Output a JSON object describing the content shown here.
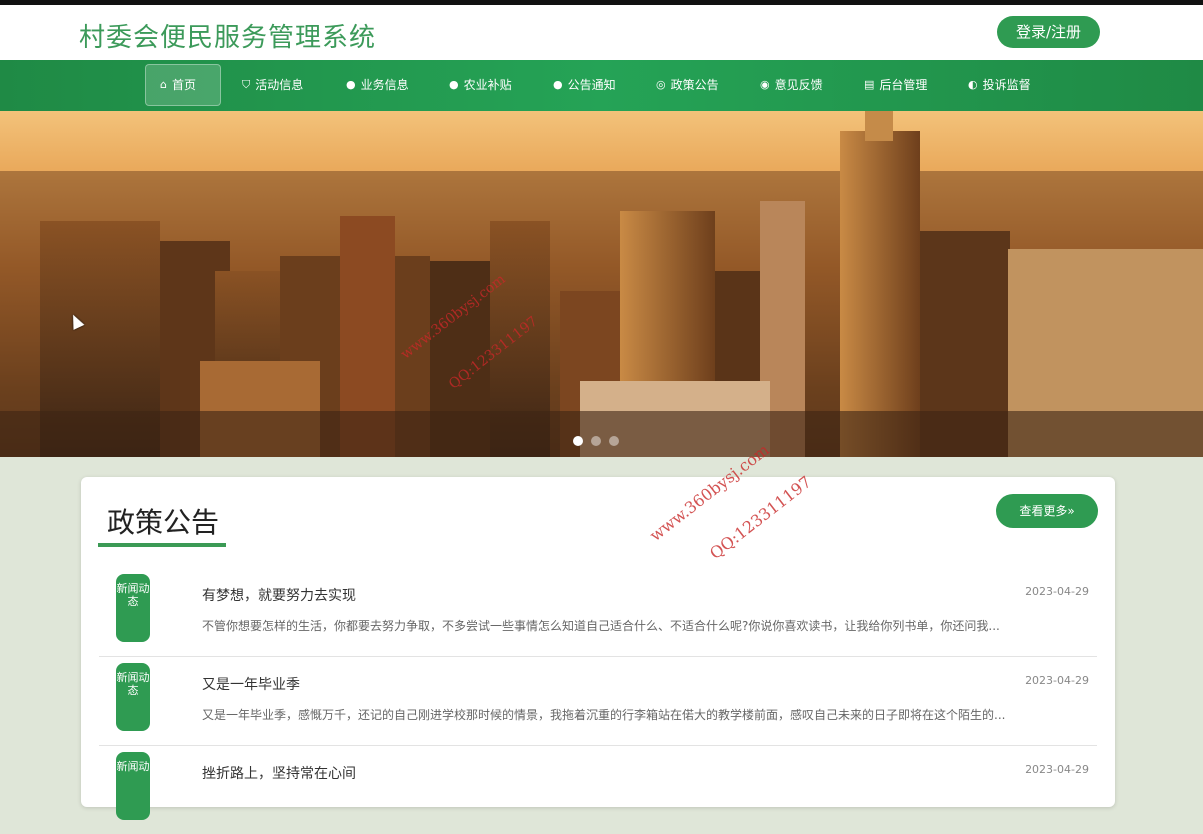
{
  "header": {
    "site_title": "村委会便民服务管理系统",
    "login_label": "登录/注册"
  },
  "nav": {
    "items": [
      {
        "icon": "home-icon",
        "glyph": "⌂",
        "label": "首页"
      },
      {
        "icon": "bag-icon",
        "glyph": "⛉",
        "label": "活动信息"
      },
      {
        "icon": "info-icon",
        "glyph": "●",
        "label": "业务信息"
      },
      {
        "icon": "help-icon",
        "glyph": "●",
        "label": "农业补贴"
      },
      {
        "icon": "info-circle-icon",
        "glyph": "●",
        "label": "公告通知"
      },
      {
        "icon": "target-icon",
        "glyph": "◎",
        "label": "政策公告"
      },
      {
        "icon": "check-circle-icon",
        "glyph": "◉",
        "label": "意见反馈"
      },
      {
        "icon": "building-icon",
        "glyph": "▤",
        "label": "后台管理"
      },
      {
        "icon": "headset-icon",
        "glyph": "◐",
        "label": "投诉监督"
      }
    ]
  },
  "watermark": {
    "line1": "www.360bysj.com",
    "line2": "QQ:123311197"
  },
  "panel": {
    "title": "政策公告",
    "more_label": "查看更多»"
  },
  "news": [
    {
      "badge": "新闻动态",
      "title": "有梦想，就要努力去实现",
      "date": "2023-04-29",
      "summary": "不管你想要怎样的生活，你都要去努力争取，不多尝试一些事情怎么知道自己适合什么、不适合什么呢?你说你喜欢读书，让我给你列书单，你还问我..."
    },
    {
      "badge": "新闻动态",
      "title": "又是一年毕业季",
      "date": "2023-04-29",
      "summary": "又是一年毕业季，感慨万千，还记的自己刚进学校那时候的情景，我拖着沉重的行李箱站在偌大的教学楼前面，感叹自己未来的日子即将在这个陌生的..."
    },
    {
      "badge": "新闻动",
      "title": "挫折路上，坚持常在心间",
      "date": "2023-04-29",
      "summary": ""
    }
  ]
}
